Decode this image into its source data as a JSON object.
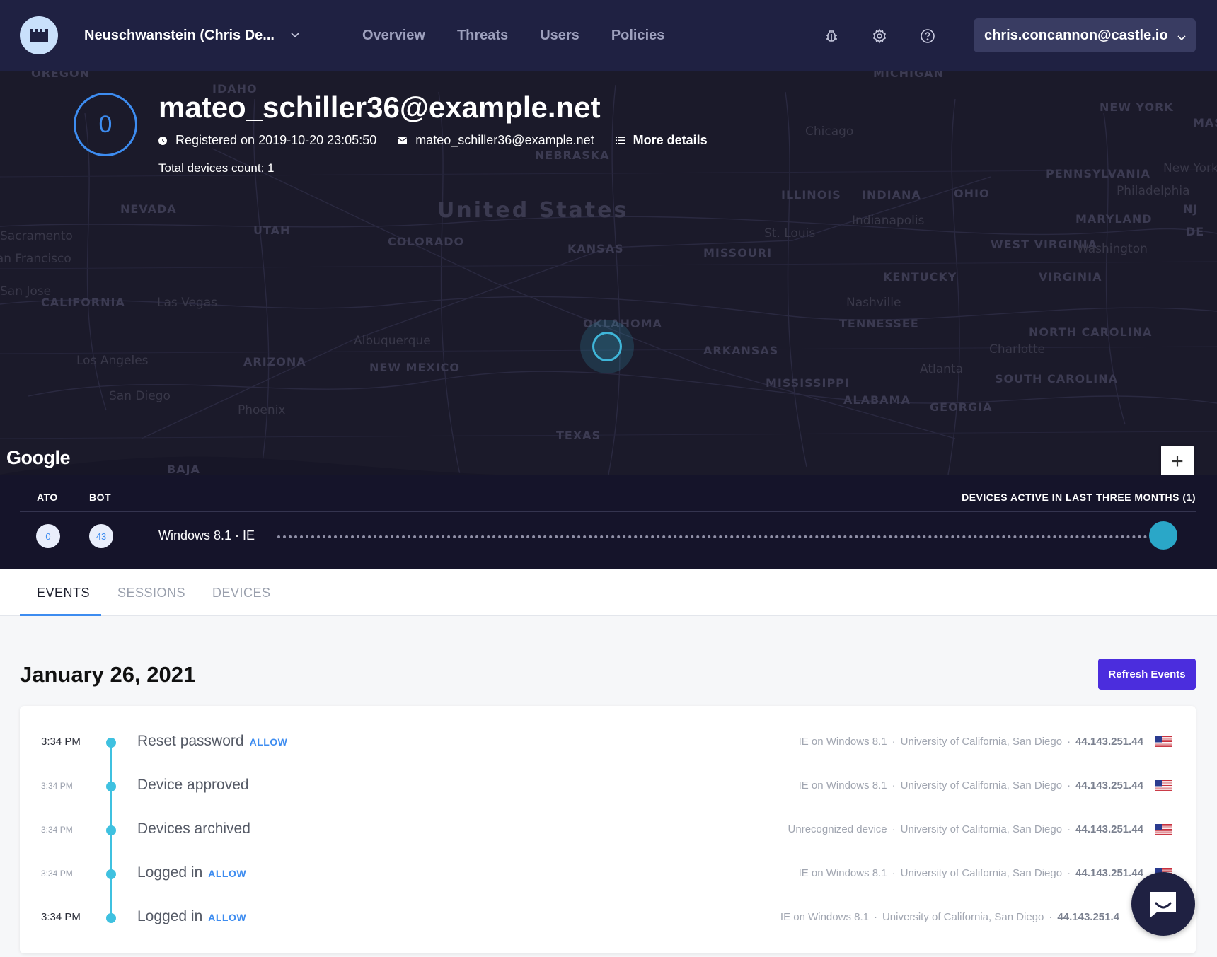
{
  "header": {
    "org_name": "Neuschwanstein (Chris De...",
    "nav": [
      "Overview",
      "Threats",
      "Users",
      "Policies"
    ],
    "user_email": "chris.concannon@castle.io"
  },
  "profile": {
    "risk_score": "0",
    "title": "mateo_schiller36@example.net",
    "registered": "Registered on 2019-10-20 23:05:50",
    "email": "mateo_schiller36@example.net",
    "more_details": "More details",
    "total_devices": "Total devices count: 1"
  },
  "map": {
    "country": "United States",
    "states": [
      "OREGON",
      "IDAHO",
      "NEVADA",
      "UTAH",
      "COLORADO",
      "CALIFORNIA",
      "ARIZONA",
      "NEW MEXICO",
      "KANSAS",
      "OKLAHOMA",
      "MISSOURI",
      "ARKANSAS",
      "TEXAS",
      "MISSISSIPPI",
      "ALABAMA",
      "GEORGIA",
      "TENNESSEE",
      "KENTUCKY",
      "ILLINOIS",
      "INDIANA",
      "OHIO",
      "PENNSYLVANIA",
      "WEST VIRGINIA",
      "VIRGINIA",
      "NORTH CAROLINA",
      "SOUTH CAROLINA",
      "MARYLAND",
      "NEBRASKA",
      "MICHIGAN",
      "NEW YORK",
      "BAJA",
      "NJ",
      "DE",
      "MAS"
    ],
    "cities": [
      "Sacramento",
      "San Francisco",
      "San Jose",
      "Las Vegas",
      "Los Angeles",
      "San Diego",
      "Phoenix",
      "Albuquerque",
      "Chicago",
      "Indianapolis",
      "St. Louis",
      "Nashville",
      "Atlanta",
      "Charlotte",
      "Washington",
      "Philadelphia",
      "New York"
    ],
    "zoom_in": "+",
    "zoom_out": "−",
    "attribution": "Google"
  },
  "devices": {
    "ato_label": "ATO",
    "bot_label": "BOT",
    "active_label": "DEVICES ACTIVE IN LAST THREE MONTHS (1)",
    "ato_score": "0",
    "bot_score": "43",
    "device_name": "Windows 8.1 · IE"
  },
  "tabs": [
    "EVENTS",
    "SESSIONS",
    "DEVICES"
  ],
  "events_section": {
    "date": "January 26, 2021",
    "refresh_label": "Refresh Events",
    "events": [
      {
        "time": "3:34 PM",
        "title": "Reset password",
        "allow": "ALLOW",
        "device": "IE on Windows 8.1",
        "location": "University of California, San Diego",
        "ip": "44.143.251.44"
      },
      {
        "time": "3:34 PM",
        "title": "Device approved",
        "allow": "",
        "device": "IE on Windows 8.1",
        "location": "University of California, San Diego",
        "ip": "44.143.251.44"
      },
      {
        "time": "3:34 PM",
        "title": "Devices archived",
        "allow": "",
        "device": "Unrecognized device",
        "location": "University of California, San Diego",
        "ip": "44.143.251.44"
      },
      {
        "time": "3:34 PM",
        "title": "Logged in",
        "allow": "ALLOW",
        "device": "IE on Windows 8.1",
        "location": "University of California, San Diego",
        "ip": "44.143.251.44"
      },
      {
        "time": "3:34 PM",
        "title": "Logged in",
        "allow": "ALLOW",
        "device": "IE on Windows 8.1",
        "location": "University of California, San Diego",
        "ip": "44.143.251.4"
      }
    ],
    "separator": "·"
  },
  "icons": {
    "brand": "castle-tower-icon",
    "bug": "bug-icon",
    "settings": "gear-icon",
    "help": "question-circle-icon",
    "clock": "clock-icon",
    "mail": "envelope-icon",
    "list": "list-icon",
    "chat": "chat-bubble-icon",
    "flag": "us-flag-icon"
  },
  "colors": {
    "nav_bg": "#1f2142",
    "accent": "#3d8cf0",
    "timeline": "#3fc1e0",
    "refresh_button": "#4b2ddd"
  }
}
